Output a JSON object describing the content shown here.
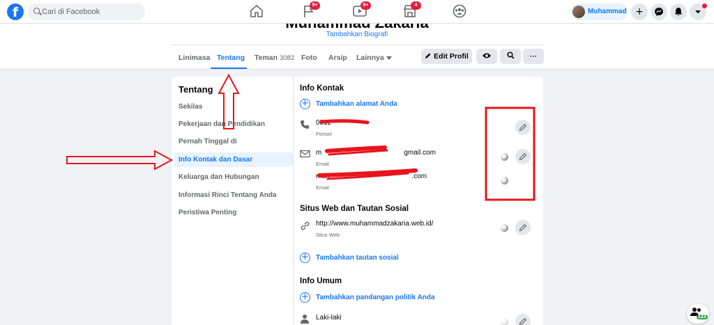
{
  "topbar": {
    "search_placeholder": "Cari di Facebook",
    "logo_letter": "f",
    "nav": [
      {
        "name": "home",
        "badge": ""
      },
      {
        "name": "pages",
        "badge": "9+"
      },
      {
        "name": "watch",
        "badge": "9+"
      },
      {
        "name": "marketplace",
        "badge": "4"
      },
      {
        "name": "groups",
        "badge": ""
      }
    ],
    "profile_name": "Muhammad",
    "plus_glyph": "+"
  },
  "profile_header": {
    "name_cut": "Muhammad Zakaria",
    "bio_link": "Tambahkan Biografi",
    "tabs": [
      {
        "label": "Linimasa",
        "count": ""
      },
      {
        "label": "Tentang",
        "count": ""
      },
      {
        "label": "Teman",
        "count": "3082"
      },
      {
        "label": "Foto",
        "count": ""
      },
      {
        "label": "Arsip",
        "count": ""
      },
      {
        "label": "Lainnya",
        "count": ""
      }
    ],
    "edit_profile_label": "Edit Profil",
    "more_glyph": "···"
  },
  "about_nav": {
    "title": "Tentang",
    "items": [
      "Sekilas",
      "Pekerjaan dan Pendidikan",
      "Pernah Tinggal di",
      "Info Kontak dan Dasar",
      "Keluarga dan Hubungan",
      "Informasi Rinci Tentang Anda",
      "Peristiwa Penting"
    ],
    "active_index": 3
  },
  "contact": {
    "title": "Info Kontak",
    "add_address": "Tambahkan alamat Anda",
    "phone_value": "0812",
    "phone_label": "Ponsel",
    "email1_prefix": "m",
    "email1_suffix": "gmail.com",
    "email1_label": "Email",
    "email2_prefix": "muh",
    "email2_suffix": ".com",
    "email2_label": "Email"
  },
  "websites": {
    "title": "Situs Web dan Tautan Sosial",
    "website_value": "http://www.muhammadzakaria.web.id/",
    "website_label": "Situs Web",
    "add_social": "Tambahkan tautan sosial"
  },
  "basic": {
    "title": "Info Umum",
    "add_politics": "Tambahkan pandangan politik Anda",
    "gender_value": "Laki-laki"
  },
  "contacts_fab": {
    "count": "123"
  },
  "annotation_color": "#e8141c"
}
